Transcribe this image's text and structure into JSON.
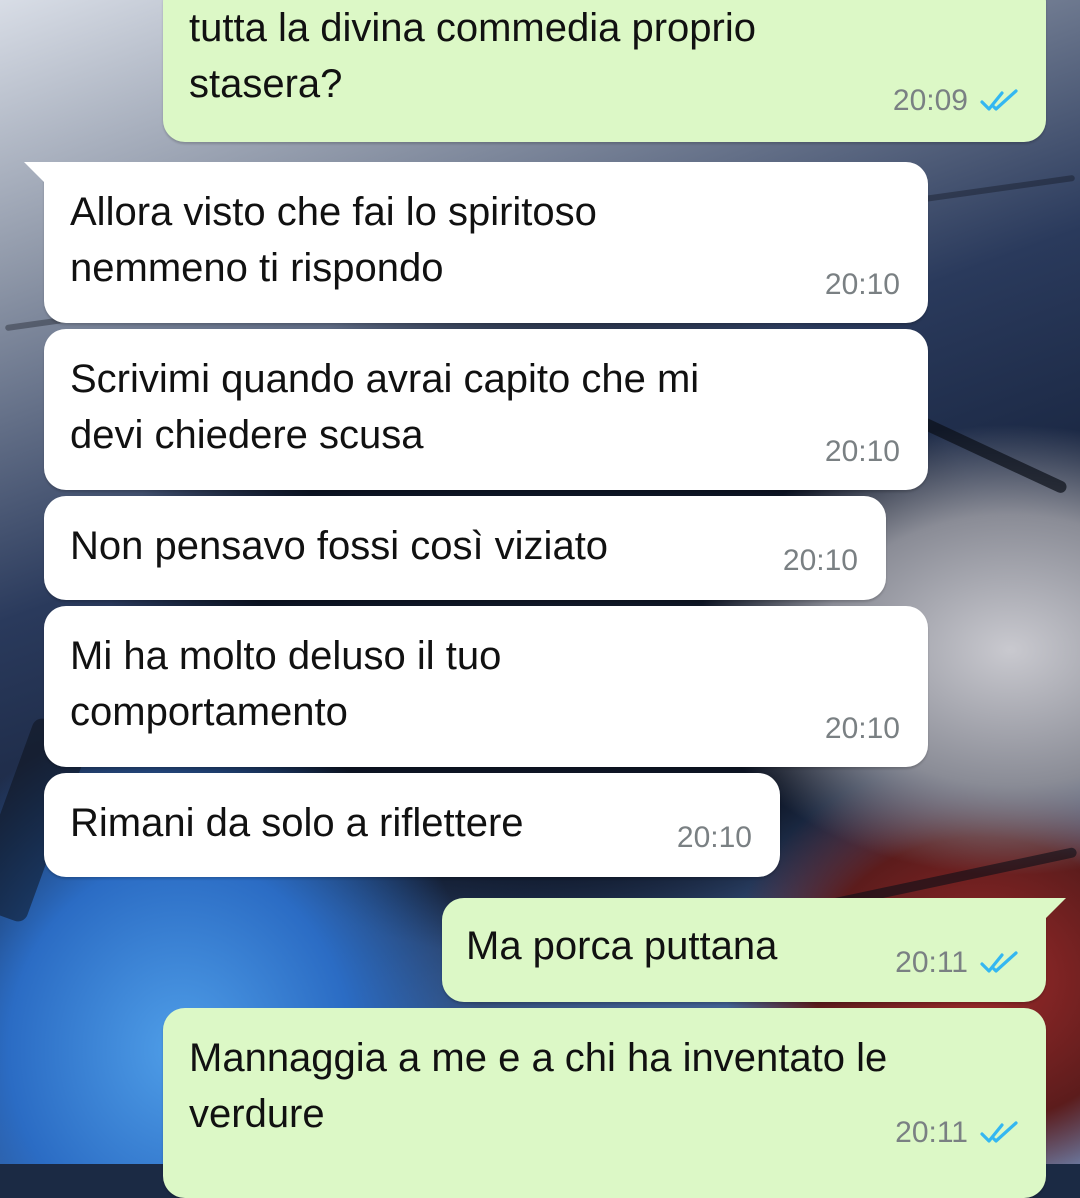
{
  "colors": {
    "incoming_bubble": "#ffffff",
    "outgoing_bubble": "#dcf8c6",
    "timestamp": "#7a8083",
    "read_ticks": "#34b7f1"
  },
  "messages": [
    {
      "direction": "outgoing",
      "text": "tutta la divina commedia proprio\nstasera?",
      "time": "20:09",
      "status_icon": "double-check-read-icon"
    },
    {
      "direction": "incoming",
      "text": "Allora visto che fai lo spiritoso\nnemmeno ti rispondo",
      "time": "20:10"
    },
    {
      "direction": "incoming",
      "text": "Scrivimi quando avrai capito che mi\ndevi chiedere scusa",
      "time": "20:10"
    },
    {
      "direction": "incoming",
      "text": "Non pensavo fossi così viziato",
      "time": "20:10"
    },
    {
      "direction": "incoming",
      "text": "Mi ha molto deluso il tuo\ncomportamento",
      "time": "20:10"
    },
    {
      "direction": "incoming",
      "text": "Rimani da solo a riflettere",
      "time": "20:10"
    },
    {
      "direction": "outgoing",
      "text": "Ma porca puttana",
      "time": "20:11",
      "status_icon": "double-check-read-icon"
    },
    {
      "direction": "outgoing",
      "text": "Mannaggia a me e a chi ha inventato le\nverdure",
      "time": "20:11",
      "status_icon": "double-check-read-icon"
    }
  ]
}
